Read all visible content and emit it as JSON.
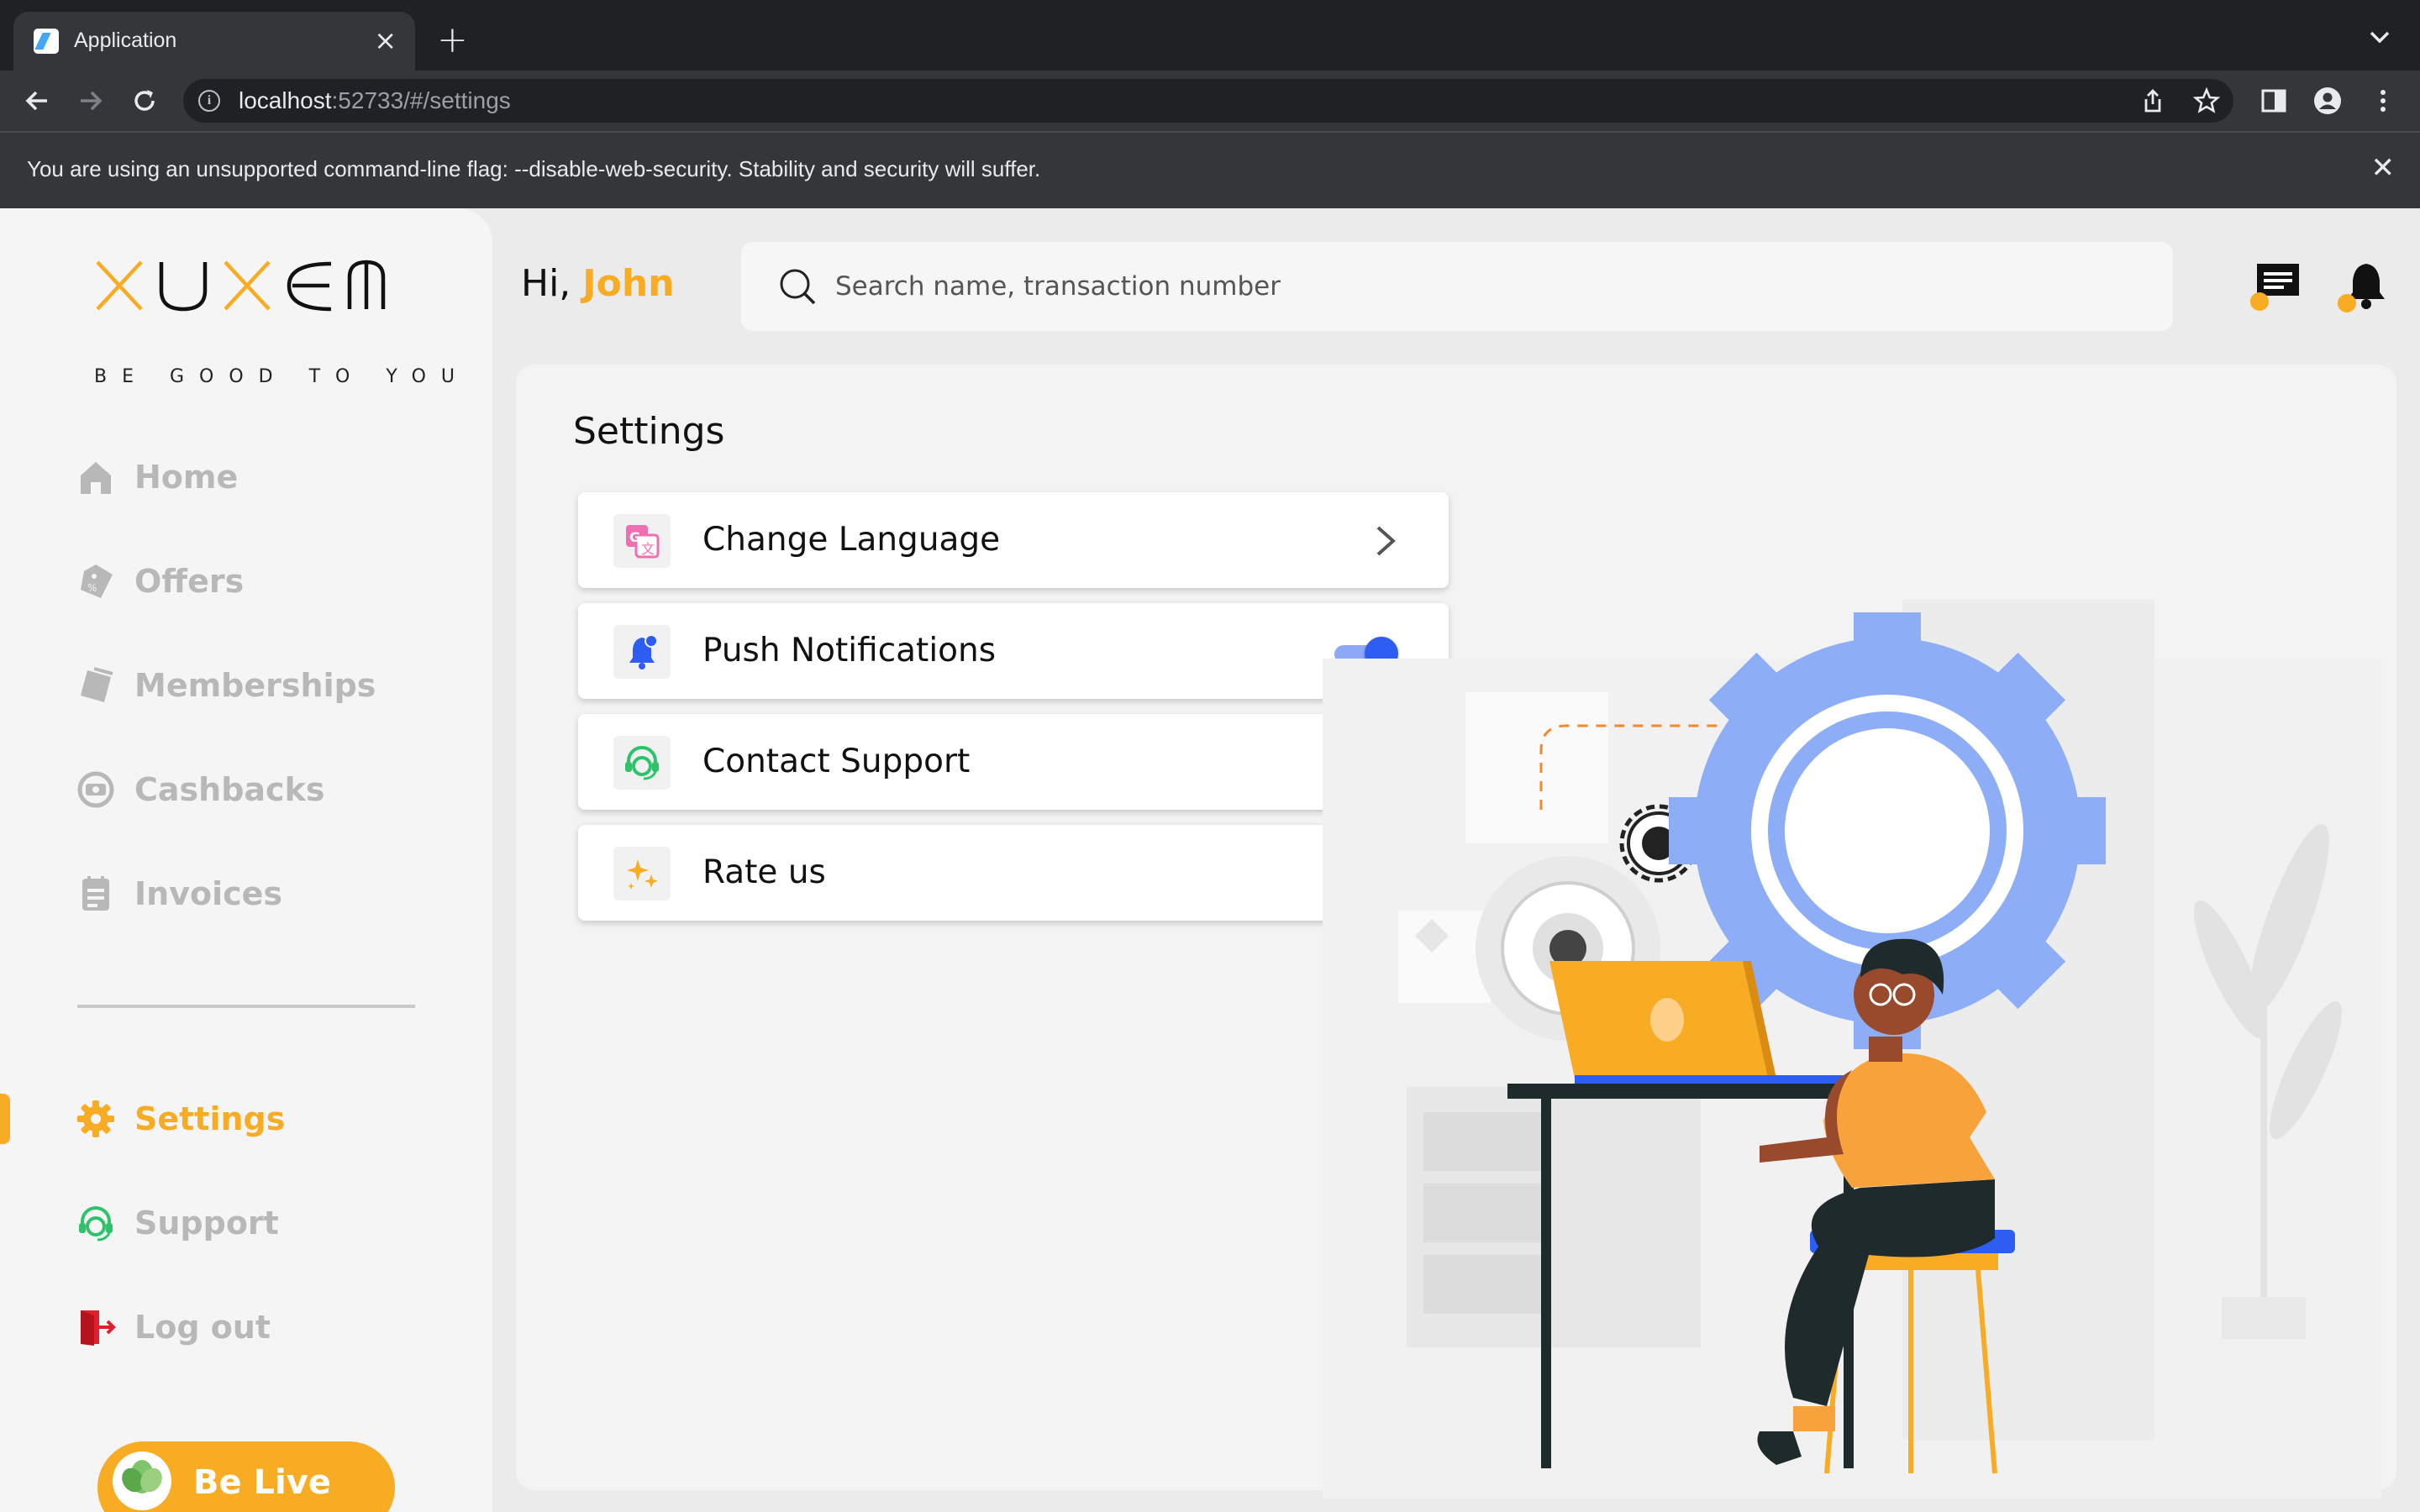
{
  "browser": {
    "tab_title": "Application",
    "url_host": "localhost",
    "url_rest": ":52733/#/settings",
    "infobar_text": "You are using an unsupported command-line flag: --disable-web-security. Stability and security will suffer."
  },
  "logo": {
    "wordmark": "XUXEM",
    "tagline": "BE GOOD TO YOU"
  },
  "header": {
    "greeting": "Hi, ",
    "user_name": "John",
    "search_placeholder": "Search name, transaction number"
  },
  "sidebar": {
    "items": [
      {
        "label": "Home",
        "icon": "home-icon",
        "active": false
      },
      {
        "label": "Offers",
        "icon": "tag-icon",
        "active": false
      },
      {
        "label": "Memberships",
        "icon": "membership-card-icon",
        "active": false
      },
      {
        "label": "Cashbacks",
        "icon": "cashback-icon",
        "active": false
      },
      {
        "label": "Invoices",
        "icon": "invoice-icon",
        "active": false
      }
    ],
    "bottom_items": [
      {
        "label": "Settings",
        "icon": "gear-icon",
        "active": true
      },
      {
        "label": "Support",
        "icon": "support-agent-icon",
        "active": false
      },
      {
        "label": "Log out",
        "icon": "logout-icon",
        "active": false
      }
    ],
    "promo_label": "Be Live"
  },
  "page": {
    "title": "Settings",
    "settings": [
      {
        "label": "Change Language",
        "icon": "translate-icon",
        "control": "chevron"
      },
      {
        "label": "Push Notifications",
        "icon": "notification-bell-icon",
        "control": "toggle",
        "value": true
      },
      {
        "label": "Contact Support",
        "icon": "support-agent-icon",
        "control": "chevron"
      },
      {
        "label": "Rate us",
        "icon": "sparkles-icon",
        "control": "chevron"
      }
    ]
  },
  "colors": {
    "accent": "#f8ac23",
    "toggle_on": "#2d5df3",
    "muted_nav": "#b8b8b8"
  }
}
